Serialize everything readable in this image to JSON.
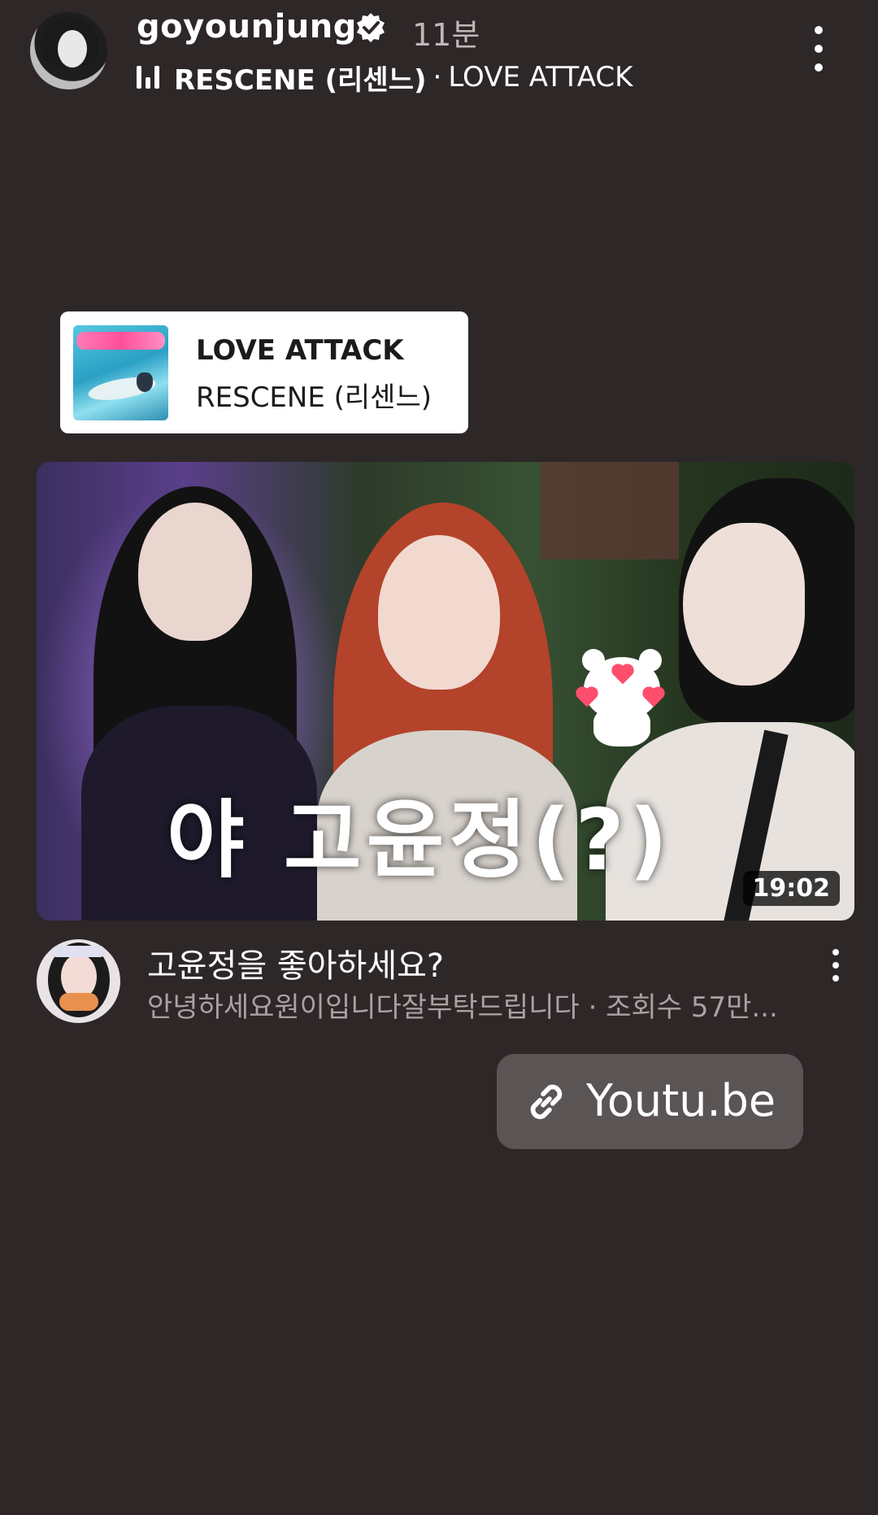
{
  "header": {
    "username": "goyounjung",
    "time_ago": "11분",
    "music_artist": "RESCENE (리센느)",
    "music_separator": "·",
    "music_title": "LOVE ATTACK",
    "icons": [
      "avatar",
      "verified-icon",
      "music-bars-icon",
      "more-vertical-icon"
    ]
  },
  "music_sticker": {
    "title": "LOVE ATTACK",
    "artist": "RESCENE (리센느)",
    "icon": "album-art"
  },
  "video": {
    "thumbnail_caption": "야 고윤정(?)",
    "duration": "19:02",
    "title": "고윤정을 좋아하세요?",
    "meta": "안녕하세요원이입니다잘부탁드립니다 · 조회수 57만...",
    "icons": [
      "channel-avatar",
      "more-vertical-icon"
    ]
  },
  "link_sticker": {
    "label": "Youtu.be",
    "icon": "link-icon"
  },
  "colors": {
    "background": "#2e2728",
    "link_button": "#5b5455",
    "secondary_text": "#a9a1a2"
  }
}
